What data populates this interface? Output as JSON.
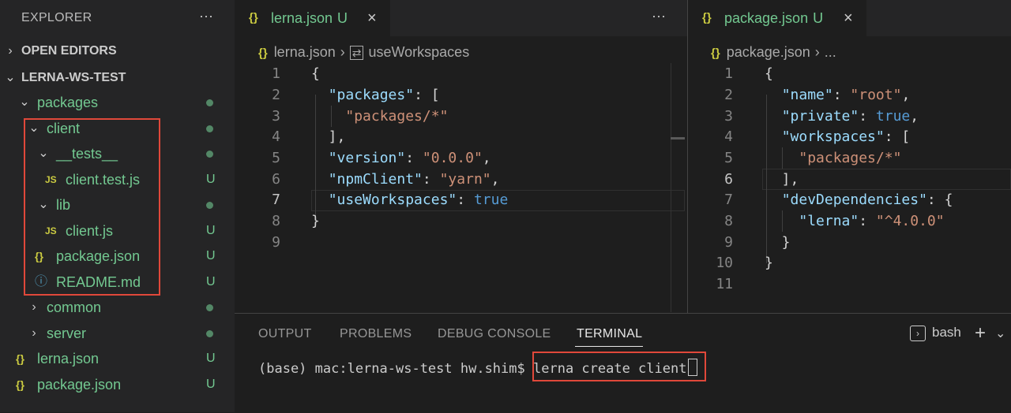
{
  "sidebar": {
    "title": "EXPLORER",
    "more": "···",
    "open_editors": "OPEN EDITORS",
    "workspace": "LERNA-WS-TEST",
    "tree": [
      {
        "name": "packages",
        "status": ""
      },
      {
        "name": "client",
        "status": ""
      },
      {
        "name": "__tests__",
        "status": ""
      },
      {
        "name": "client.test.js",
        "status": "U",
        "icon": "JS"
      },
      {
        "name": "lib",
        "status": ""
      },
      {
        "name": "client.js",
        "status": "U",
        "icon": "JS"
      },
      {
        "name": "package.json",
        "status": "U",
        "icon": "{}"
      },
      {
        "name": "README.md",
        "status": "U",
        "icon": "ⓘ"
      },
      {
        "name": "common",
        "status": ""
      },
      {
        "name": "server",
        "status": ""
      },
      {
        "name": "lerna.json",
        "status": "U",
        "icon": "{}"
      },
      {
        "name": "package.json",
        "status": "U",
        "icon": "{}"
      }
    ]
  },
  "editor_left": {
    "tab_icon": "{}",
    "tab_label": "lerna.json",
    "tab_status": "U",
    "breadcrumb_file": "lerna.json",
    "breadcrumb_symbol": "useWorkspaces",
    "more": "···"
  },
  "editor_right": {
    "tab_icon": "{}",
    "tab_label": "package.json",
    "tab_status": "U",
    "breadcrumb_file": "package.json",
    "breadcrumb_rest": "..."
  },
  "panel": {
    "tabs": [
      "OUTPUT",
      "PROBLEMS",
      "DEBUG CONSOLE",
      "TERMINAL"
    ],
    "active_tab": "TERMINAL",
    "shell": "bash",
    "prompt": "(base) mac:lerna-ws-test hw.shim$ ",
    "command": "lerna create client"
  },
  "colors": {
    "accent_box": "#e0483a",
    "untracked": "#73c991",
    "json_icon": "#cbcb41"
  }
}
